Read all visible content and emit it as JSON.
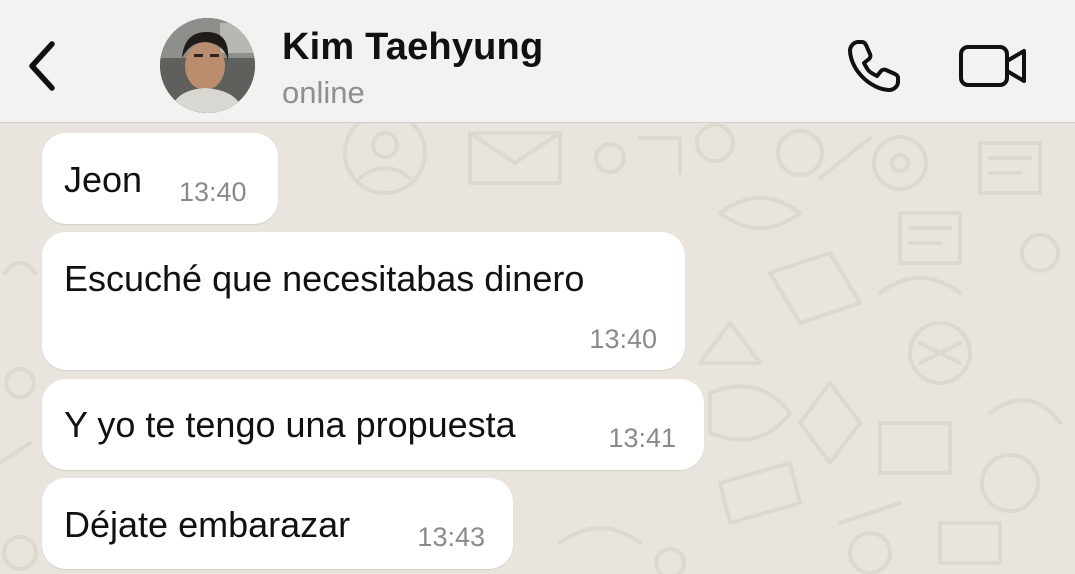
{
  "header": {
    "contact_name": "Kim Taehyung",
    "status": "online",
    "back_icon": "chevron-left-icon",
    "call_icon": "phone-icon",
    "video_icon": "video-camera-icon"
  },
  "messages": [
    {
      "text": "Jeon",
      "time": "13:40",
      "direction": "incoming"
    },
    {
      "text": "Escuché que necesitabas dinero",
      "time": "13:40",
      "direction": "incoming"
    },
    {
      "text": "Y yo te tengo una propuesta",
      "time": "13:41",
      "direction": "incoming"
    },
    {
      "text": "Déjate embarazar",
      "time": "13:43",
      "direction": "incoming"
    }
  ],
  "colors": {
    "header_bg": "#f3f2f0",
    "chat_bg": "#e9e5de",
    "bubble_bg": "#ffffff",
    "time_text": "#8a8a8a",
    "status_text": "#8e8e93"
  }
}
